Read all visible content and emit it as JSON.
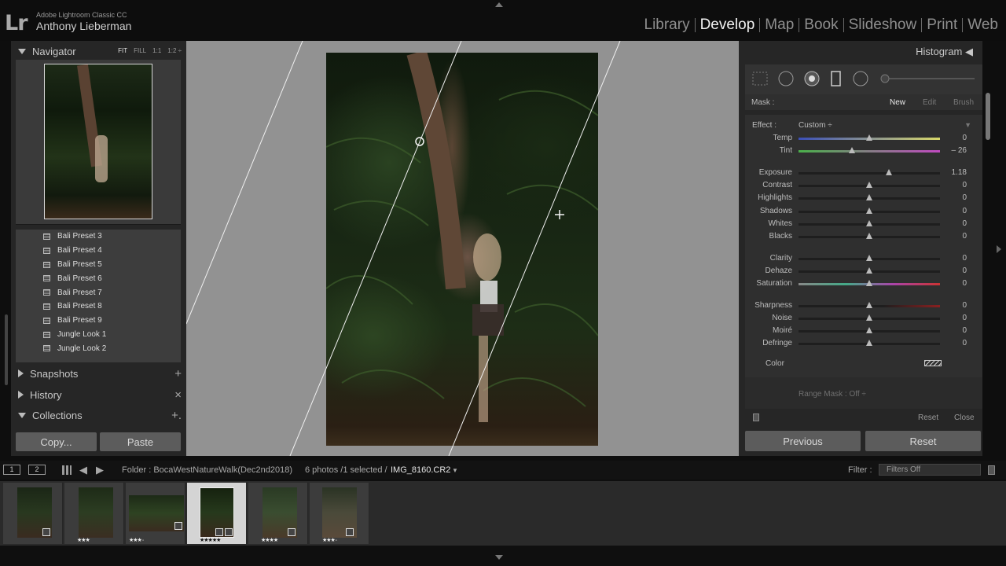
{
  "header": {
    "app_name": "Adobe Lightroom Classic CC",
    "user_name": "Anthony Lieberman",
    "logo": "Lr",
    "modules": [
      "Library",
      "Develop",
      "Map",
      "Book",
      "Slideshow",
      "Print",
      "Web"
    ],
    "active_module": "Develop"
  },
  "left": {
    "navigator": {
      "title": "Navigator",
      "zoom_options": [
        "FIT",
        "FILL",
        "1:1",
        "1:2 ÷"
      ]
    },
    "presets": [
      "Bali Preset 3",
      "Bali Preset 4",
      "Bali Preset 5",
      "Bali Preset 6",
      "Bali Preset 7",
      "Bali Preset 8",
      "Bali Preset 9",
      "Jungle Look 1",
      "Jungle Look 2"
    ],
    "snapshots": {
      "title": "Snapshots",
      "action": "+"
    },
    "history": {
      "title": "History",
      "action": "×"
    },
    "collections": {
      "title": "Collections",
      "action": "+."
    },
    "copy_label": "Copy...",
    "paste_label": "Paste"
  },
  "right": {
    "histogram_title": "Histogram",
    "mask": {
      "label": "Mask :",
      "new": "New",
      "edit": "Edit",
      "brush": "Brush"
    },
    "effect": {
      "label": "Effect :",
      "value": "Custom ÷"
    },
    "adjustments": [
      {
        "name": "Temp",
        "value": "0",
        "pos": 0.5,
        "track": "temp"
      },
      {
        "name": "Tint",
        "value": "– 26",
        "pos": 0.38,
        "track": "tint"
      },
      {
        "name": "Exposure",
        "value": "1.18",
        "pos": 0.64,
        "track": "plain"
      },
      {
        "name": "Contrast",
        "value": "0",
        "pos": 0.5,
        "track": "plain"
      },
      {
        "name": "Highlights",
        "value": "0",
        "pos": 0.5,
        "track": "plain"
      },
      {
        "name": "Shadows",
        "value": "0",
        "pos": 0.5,
        "track": "plain"
      },
      {
        "name": "Whites",
        "value": "0",
        "pos": 0.5,
        "track": "plain"
      },
      {
        "name": "Blacks",
        "value": "0",
        "pos": 0.5,
        "track": "plain"
      },
      {
        "name": "Clarity",
        "value": "0",
        "pos": 0.5,
        "track": "plain"
      },
      {
        "name": "Dehaze",
        "value": "0",
        "pos": 0.5,
        "track": "plain"
      },
      {
        "name": "Saturation",
        "value": "0",
        "pos": 0.5,
        "track": "sat"
      },
      {
        "name": "Sharpness",
        "value": "0",
        "pos": 0.5,
        "track": "sharp"
      },
      {
        "name": "Noise",
        "value": "0",
        "pos": 0.5,
        "track": "plain"
      },
      {
        "name": "Moiré",
        "value": "0",
        "pos": 0.5,
        "track": "plain"
      },
      {
        "name": "Defringe",
        "value": "0",
        "pos": 0.5,
        "track": "plain"
      }
    ],
    "color_label": "Color",
    "range_mask": "Range Mask : Off ÷",
    "reset_label": "Reset",
    "close_label": "Close",
    "previous_label": "Previous",
    "reset_all_label": "Reset"
  },
  "filmbar": {
    "monitor1": "1",
    "monitor2": "2",
    "folder": "Folder : BocaWestNatureWalk(Dec2nd2018)",
    "count": "6 photos /1 selected /",
    "filename": "IMG_8160.CR2",
    "filter_label": "Filter :",
    "filter_value": "Filters Off"
  },
  "filmstrip": [
    {
      "stars": "",
      "selected": false
    },
    {
      "stars": "★★★",
      "selected": false
    },
    {
      "stars": "★★★··",
      "selected": false
    },
    {
      "stars": "★★★★★",
      "selected": true
    },
    {
      "stars": "★★★★",
      "selected": false
    },
    {
      "stars": "★★★··",
      "selected": false
    }
  ],
  "colors": {
    "active_text": "#f2f2f2",
    "panel_bg": "#262626",
    "canvas_bg": "#929292"
  }
}
